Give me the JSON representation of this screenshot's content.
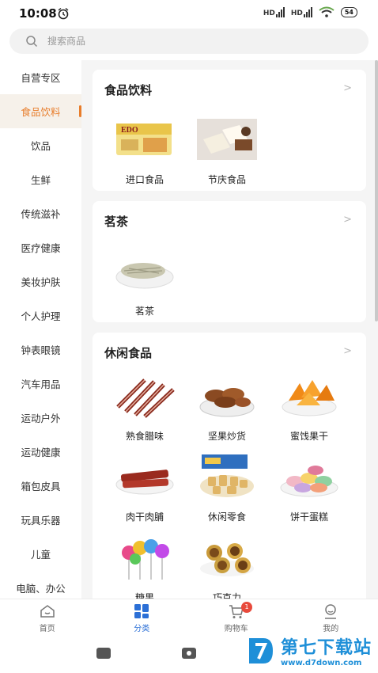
{
  "status_bar": {
    "time": "10:08",
    "hd1": "HD",
    "hd2": "HD",
    "battery": "54"
  },
  "search": {
    "placeholder": "搜索商品"
  },
  "sidebar": {
    "items": [
      {
        "label": "自营专区"
      },
      {
        "label": "食品饮料",
        "active": true
      },
      {
        "label": "饮品"
      },
      {
        "label": "生鲜"
      },
      {
        "label": "传统滋补"
      },
      {
        "label": "医疗健康"
      },
      {
        "label": "美妆护肤"
      },
      {
        "label": "个人护理"
      },
      {
        "label": "钟表眼镜"
      },
      {
        "label": "汽车用品"
      },
      {
        "label": "运动户外"
      },
      {
        "label": "运动健康"
      },
      {
        "label": "箱包皮具"
      },
      {
        "label": "玩具乐器"
      },
      {
        "label": "儿童"
      },
      {
        "label": "电脑、办公"
      }
    ]
  },
  "sections": [
    {
      "title": "食品饮料",
      "chevron": ">",
      "items": [
        {
          "label": "进口食品",
          "icon": "imported-food-thumb"
        },
        {
          "label": "节庆食品",
          "icon": "festival-food-thumb"
        }
      ]
    },
    {
      "title": "茗茶",
      "chevron": ">",
      "items": [
        {
          "label": "茗茶",
          "icon": "tea-thumb"
        }
      ]
    },
    {
      "title": "休闲食品",
      "chevron": ">",
      "items": [
        {
          "label": "熟食腊味",
          "icon": "cured-meat-thumb"
        },
        {
          "label": "坚果炒货",
          "icon": "nuts-thumb"
        },
        {
          "label": "蜜饯果干",
          "icon": "dried-fruit-thumb"
        },
        {
          "label": "肉干肉脯",
          "icon": "jerky-thumb"
        },
        {
          "label": "休闲零食",
          "icon": "snacks-thumb"
        },
        {
          "label": "饼干蛋糕",
          "icon": "macaron-thumb"
        },
        {
          "label": "糖果",
          "icon": "lollipop-thumb"
        },
        {
          "label": "巧克力",
          "icon": "chocolate-thumb"
        }
      ]
    }
  ],
  "bottom_nav": {
    "items": [
      {
        "label": "首页",
        "icon": "home-icon"
      },
      {
        "label": "分类",
        "icon": "category-icon",
        "active": true
      },
      {
        "label": "购物车",
        "icon": "cart-icon",
        "badge": "1"
      },
      {
        "label": "我的",
        "icon": "user-icon"
      }
    ]
  },
  "watermark": {
    "brand": "第七下载站",
    "url": "www.d7down.com"
  },
  "colors": {
    "accent": "#e87d2b",
    "nav_active": "#2b6fd6",
    "badge": "#e84a3c"
  }
}
